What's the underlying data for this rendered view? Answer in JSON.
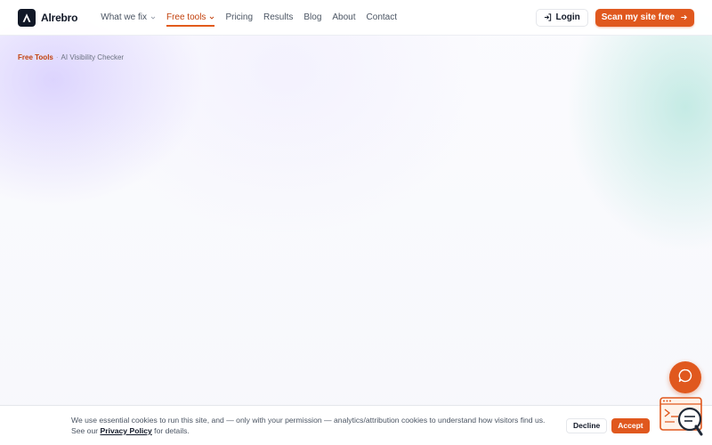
{
  "brand": {
    "name": "Alrebro"
  },
  "nav": {
    "items": [
      {
        "label": "What we fix",
        "has_dropdown": true,
        "active": false
      },
      {
        "label": "Free tools",
        "has_dropdown": true,
        "active": true
      },
      {
        "label": "Pricing",
        "has_dropdown": false,
        "active": false
      },
      {
        "label": "Results",
        "has_dropdown": false,
        "active": false
      },
      {
        "label": "Blog",
        "has_dropdown": false,
        "active": false
      },
      {
        "label": "About",
        "has_dropdown": false,
        "active": false
      },
      {
        "label": "Contact",
        "has_dropdown": false,
        "active": false
      }
    ],
    "login_label": "Login",
    "login_icon": "login-icon",
    "cta_label": "Scan my site free",
    "cta_icon": "arrow-right-icon"
  },
  "breadcrumb": {
    "parent": "Free Tools",
    "separator": "·",
    "current": "AI Visibility Checker"
  },
  "cookie_banner": {
    "text_before": "We use essential cookies to run this site, and — only with your permission — analytics/attribution cookies to understand how visitors find us. See our ",
    "policy_link": "Privacy Policy",
    "text_after": " for details.",
    "decline_label": "Decline",
    "accept_label": "Accept"
  },
  "colors": {
    "accent": "#e0581e",
    "accent_text": "#c2410c",
    "dark": "#111827",
    "muted_text": "#4b5563"
  },
  "floating": {
    "chat_icon": "chat-bubble-icon",
    "widget_icon": "support-widget-icon"
  }
}
